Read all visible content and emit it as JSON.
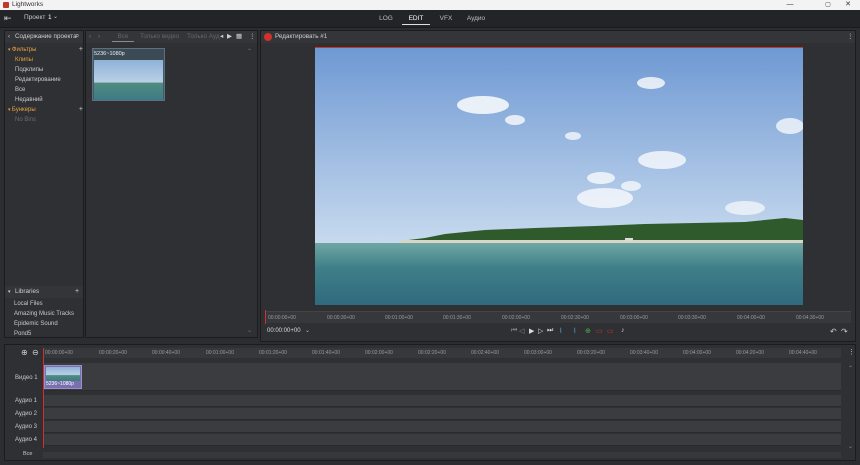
{
  "app": {
    "title": "Lightworks"
  },
  "window_controls": {
    "minimize": "—",
    "maximize": "▢",
    "close": "✕"
  },
  "menubar": {
    "project_label": "Проект",
    "project_number": "1",
    "tabs": [
      "LOG",
      "EDIT",
      "VFX",
      "Аудио"
    ],
    "active_tab": "EDIT"
  },
  "project_panel": {
    "header": "Содержание проекта",
    "tree": {
      "filters_label": "Фильтры",
      "filter_items": [
        "Клипы",
        "Подклипы",
        "Редактирование",
        "Все",
        "Недавний"
      ],
      "bins_label": "Бункеры",
      "bins_items": [
        "No Bins"
      ]
    },
    "libraries": {
      "header": "Libraries",
      "items": [
        "Local Files",
        "Amazing Music Tracks",
        "Epidemic Sound",
        "Pond5"
      ]
    }
  },
  "browser": {
    "tabs": [
      "Все",
      "Только видео",
      "Только Ауд"
    ],
    "clip": {
      "name": "5236~1080p"
    }
  },
  "viewer": {
    "title": "Редактировать #1",
    "timecode": "00:00:00+00",
    "ruler": [
      "00:00:00+00",
      "00:00:30+00",
      "00:01:00+00",
      "00:01:30+00",
      "00:02:00+00",
      "00:02:30+00",
      "00:03:00+00",
      "00:03:30+00",
      "00:04:00+00",
      "00:04:30+00"
    ]
  },
  "timeline": {
    "ruler": [
      "00:00:00+00",
      "00:00:20+00",
      "00:00:40+00",
      "00:01:00+00",
      "00:01:20+00",
      "00:01:40+00",
      "00:02:00+00",
      "00:02:20+00",
      "00:02:40+00",
      "00:03:00+00",
      "00:03:20+00",
      "00:03:40+00",
      "00:04:00+00",
      "00:04:20+00",
      "00:04:40+00"
    ],
    "tracks": [
      "Видео 1",
      "Аудио 1",
      "Аудио 2",
      "Аудио 3",
      "Аудио 4"
    ],
    "all_label": "Все",
    "clip_name": "5236~1080p"
  },
  "colors": {
    "accent_orange": "#e8a33d",
    "record_red": "#d0312d",
    "clip_purple": "#7b6fb0"
  }
}
